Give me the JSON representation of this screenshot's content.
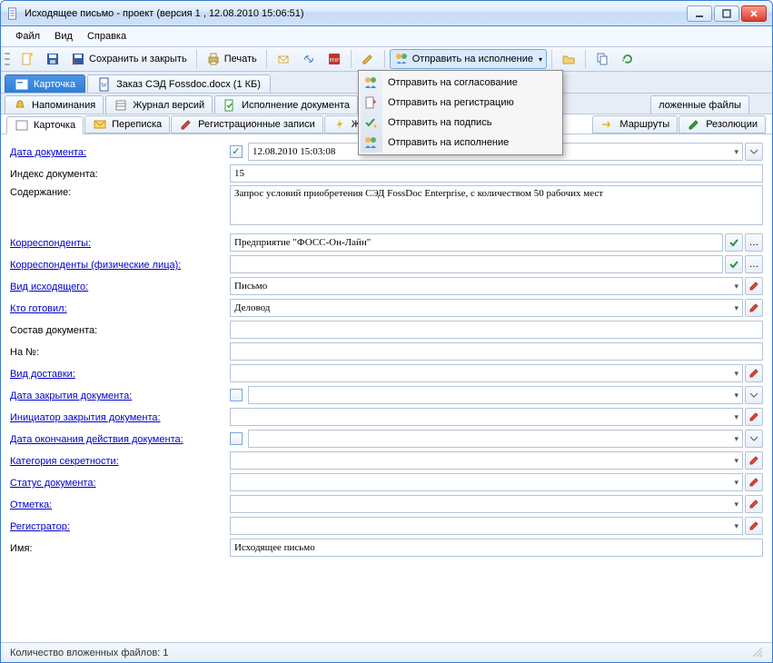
{
  "window": {
    "title": "Исходящее письмо - проект (версия 1 , 12.08.2010 15:06:51)"
  },
  "menu": {
    "file": "Файл",
    "view": "Вид",
    "help": "Справка"
  },
  "toolbar": {
    "save_close": "Сохранить и закрыть",
    "print": "Печать",
    "send_exec": "Отправить на исполнение"
  },
  "doc_tabs": {
    "card": "Карточка",
    "doc_attach": "Заказ СЭД Fossdoc.docx (1 КБ)"
  },
  "mid_tabs": {
    "reminders": "Напоминания",
    "versions": "Журнал версий",
    "exec_doc": "Исполнение документа",
    "attached": "ложенные файлы"
  },
  "inner_tabs": {
    "card": "Карточка",
    "corr": "Переписка",
    "reg": "Регистрационные записи",
    "jrn": "Жу",
    "routes": "Маршруты",
    "res": "Резолюции"
  },
  "send_menu": {
    "agree": "Отправить на согласование",
    "register": "Отправить на регистрацию",
    "sign": "Отправить на подпись",
    "exec": "Отправить на исполнение"
  },
  "labels": {
    "doc_date": "Дата документа:",
    "doc_index": "Индекс документа:",
    "content": "Содержание:",
    "corr": "Корреспонденты:",
    "corr_phys": "Корреспонденты (физические лица):",
    "out_type": "Вид исходящего:",
    "prepared": "Кто готовил:",
    "doc_comp": "Состав документа:",
    "on_no": "На №:",
    "delivery": "Вид доставки:",
    "close_date": "Дата закрытия документа:",
    "close_init": "Инициатор закрытия документа:",
    "end_date": "Дата окончания действия документа:",
    "secrecy": "Категория секретности:",
    "status": "Статус документа:",
    "mark": "Отметка:",
    "registrar": "Регистратор:",
    "name": "Имя:"
  },
  "values": {
    "doc_date": "12.08.2010 15:03:08",
    "doc_index": "15",
    "content": "Запрос условий приобретения СЭД FossDoc Enterprise, с количеством 50 рабочих мест",
    "corr": "Предприятие \"ФОСС-Он-Лайн\"",
    "out_type": "Письмо",
    "prepared": "Деловод",
    "name": "Исходящее письмо"
  },
  "status_bar": {
    "text": "Количество вложенных файлов: 1"
  }
}
